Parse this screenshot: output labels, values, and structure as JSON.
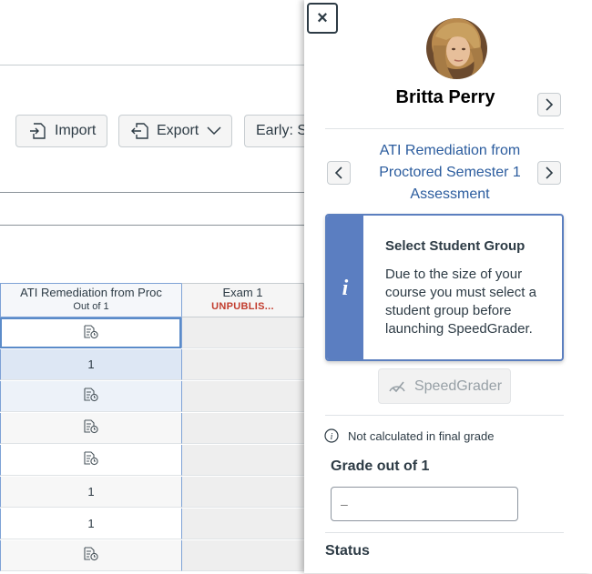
{
  "toolbar": {
    "import_label": "Import",
    "export_label": "Export",
    "filter_label": "Early: S"
  },
  "gradebook": {
    "columns": [
      {
        "title": "ATI Remediation from Proc",
        "subtitle": "Out of 1"
      },
      {
        "title": "Exam 1",
        "subtitle": "UNPUBLIS..."
      }
    ],
    "rows": [
      {
        "value": "",
        "icon": "submission-icon"
      },
      {
        "value": "1",
        "icon": ""
      },
      {
        "value": "",
        "icon": "submission-icon"
      },
      {
        "value": "",
        "icon": "submission-icon"
      },
      {
        "value": "",
        "icon": "submission-icon"
      },
      {
        "value": "1",
        "icon": ""
      },
      {
        "value": "1",
        "icon": ""
      },
      {
        "value": "",
        "icon": "submission-icon"
      }
    ]
  },
  "tray": {
    "close_label": "×",
    "student_name": "Britta Perry",
    "assignment_title": "ATI Remediation from Proctored Semester 1 Assessment",
    "alert": {
      "icon": "i",
      "title": "Select Student Group",
      "body": "Due to the size of your course you must select a student group before launching SpeedGrader."
    },
    "speedgrader_label": "SpeedGrader",
    "note": "Not calculated in final grade",
    "grade_label": "Grade out of 1",
    "grade_placeholder": "–",
    "status_label": "Status"
  },
  "colors": {
    "accent_blue": "#5b7ec1",
    "link_blue": "#2b5c9e",
    "unpublished_red": "#c23c2d",
    "selected_row": "#dde7f4",
    "hover_row": "#edf2f9"
  }
}
